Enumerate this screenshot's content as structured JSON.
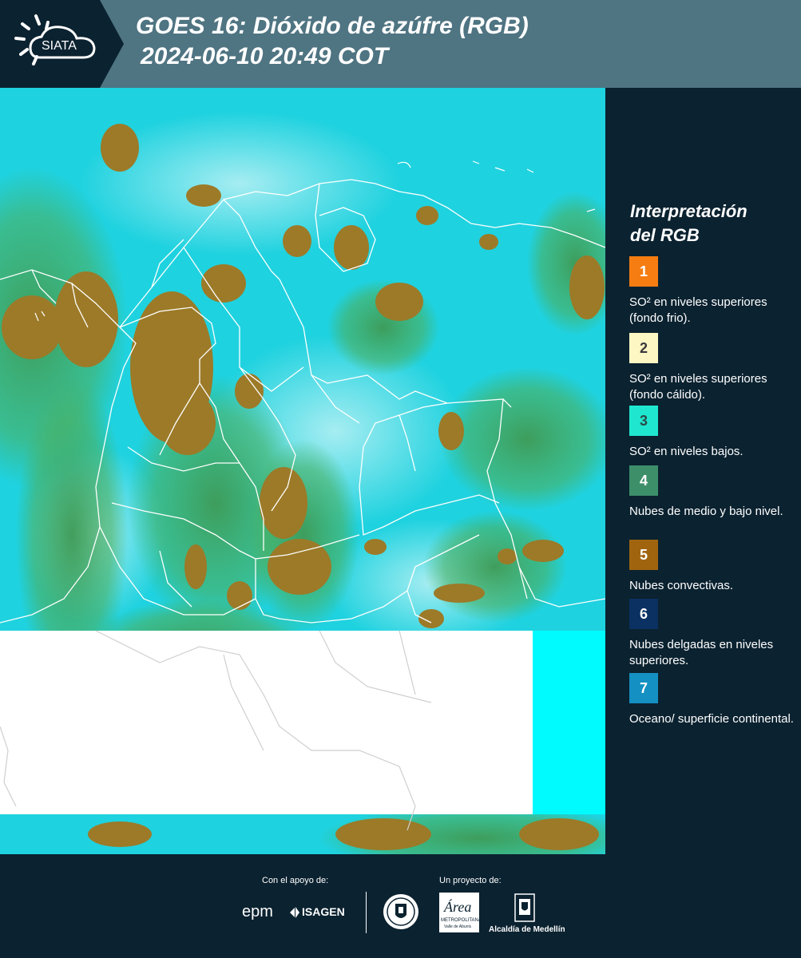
{
  "header": {
    "logo_text": "SIATA",
    "title_line1": "GOES 16: Dióxido de azúfre (RGB)",
    "title_line2": "2024-06-10 20:49 COT"
  },
  "legend": {
    "title_line1": "Interpretación",
    "title_line2": "del RGB",
    "items": [
      {
        "number": "1",
        "color": "#f57d12",
        "label": "SO² en niveles superiores (fondo frio)."
      },
      {
        "number": "2",
        "color": "#fdf7c4",
        "label": "SO² en niveles superiores (fondo cálido)."
      },
      {
        "number": "3",
        "color": "#1fe7cf",
        "label": "SO² en niveles bajos."
      },
      {
        "number": "4",
        "color": "#3d8f6a",
        "label": "Nubes de medio y bajo nivel."
      },
      {
        "number": "5",
        "color": "#a0640f",
        "label": "Nubes convectivas."
      },
      {
        "number": "6",
        "color": "#0a3162",
        "label": "Nubes delgadas en niveles superiores."
      },
      {
        "number": "7",
        "color": "#1490c2",
        "label": "Oceano/ superficie continental."
      }
    ]
  },
  "footer": {
    "support_label": "Con el apoyo de:",
    "project_label": "Un proyecto de:",
    "sponsor1": "epm",
    "sponsor2": "ISAGEN",
    "partner_area": "Área",
    "partner_area_sub": "METROPOLITANA",
    "partner_area_sub2": "Valle de Aburrá",
    "partner_alcaldia": "Alcaldía de Medellín"
  }
}
